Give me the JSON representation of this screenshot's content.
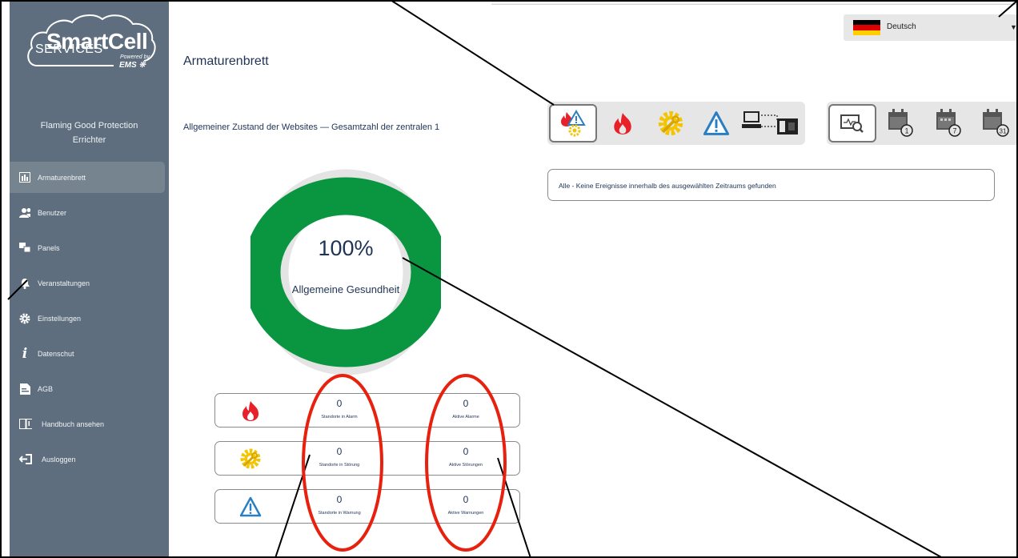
{
  "app": {
    "logo_word": "SmartCell",
    "logo_services": "SERVICES",
    "logo_powered": "Powered by",
    "logo_ems": "EMS ❊"
  },
  "sidebar": {
    "company_line1": "Flaming Good Protection",
    "company_line2": "Errichter",
    "items": [
      {
        "label": "Armaturenbrett",
        "icon": "dashboard-chart-icon"
      },
      {
        "label": "Benutzer",
        "icon": "users-icon"
      },
      {
        "label": "Panels",
        "icon": "panels-icon"
      },
      {
        "label": "Veranstaltungen",
        "icon": "bell-icon"
      },
      {
        "label": "Einstellungen",
        "icon": "gear-icon"
      },
      {
        "label": "Datenschut",
        "icon": "info-icon"
      },
      {
        "label": "AGB",
        "icon": "document-icon"
      },
      {
        "label": "Handbuch ansehen",
        "icon": "book-icon"
      },
      {
        "label": "Ausloggen",
        "icon": "logout-icon"
      }
    ]
  },
  "header": {
    "title": "Armaturenbrett"
  },
  "language": {
    "selected": "Deutsch",
    "flag_colors": [
      "#000000",
      "#dd0000",
      "#ffce00"
    ]
  },
  "health": {
    "title": "Allgemeiner Zustand der Websites — Gesamtzahl der zentralen 1",
    "percent_label": "100%",
    "percent_value": 100,
    "label": "Allgemeine Gesundheit",
    "ring_color": "#0a9640"
  },
  "stats": [
    {
      "icon": "fire-icon",
      "sites_value": "0",
      "sites_caption": "Standorte in Alarm",
      "active_value": "0",
      "active_caption": "Aktive Alarme"
    },
    {
      "icon": "fault-gear-icon",
      "sites_value": "0",
      "sites_caption": "Standorte in Störung",
      "active_value": "0",
      "active_caption": "Aktive Störungen"
    },
    {
      "icon": "warning-icon",
      "sites_value": "0",
      "sites_caption": "Standorte in Warnung",
      "active_value": "0",
      "active_caption": "Aktive Warnungen"
    }
  ],
  "filters": {
    "event_types": [
      "all-events-icon",
      "fire-icon",
      "fault-gear-icon",
      "warning-icon",
      "panel-connection-icon"
    ],
    "selected_event_type": "all-events-icon",
    "periods": [
      "monitor-search-icon",
      "calendar-1-day-icon",
      "calendar-7-days-icon",
      "calendar-31-days-icon"
    ],
    "period_badges": [
      "1",
      "7",
      "31"
    ],
    "selected_period": "monitor-search-icon"
  },
  "events": {
    "message": "Alle - Keine Ereignisse innerhalb des ausgewählten Zeitraums gefunden"
  },
  "colors": {
    "sidebar": "#5e6e7e",
    "fire": "#e8202a",
    "fault": "#f5c400",
    "warning": "#2a7fc4",
    "annotation": "#e8200e"
  }
}
